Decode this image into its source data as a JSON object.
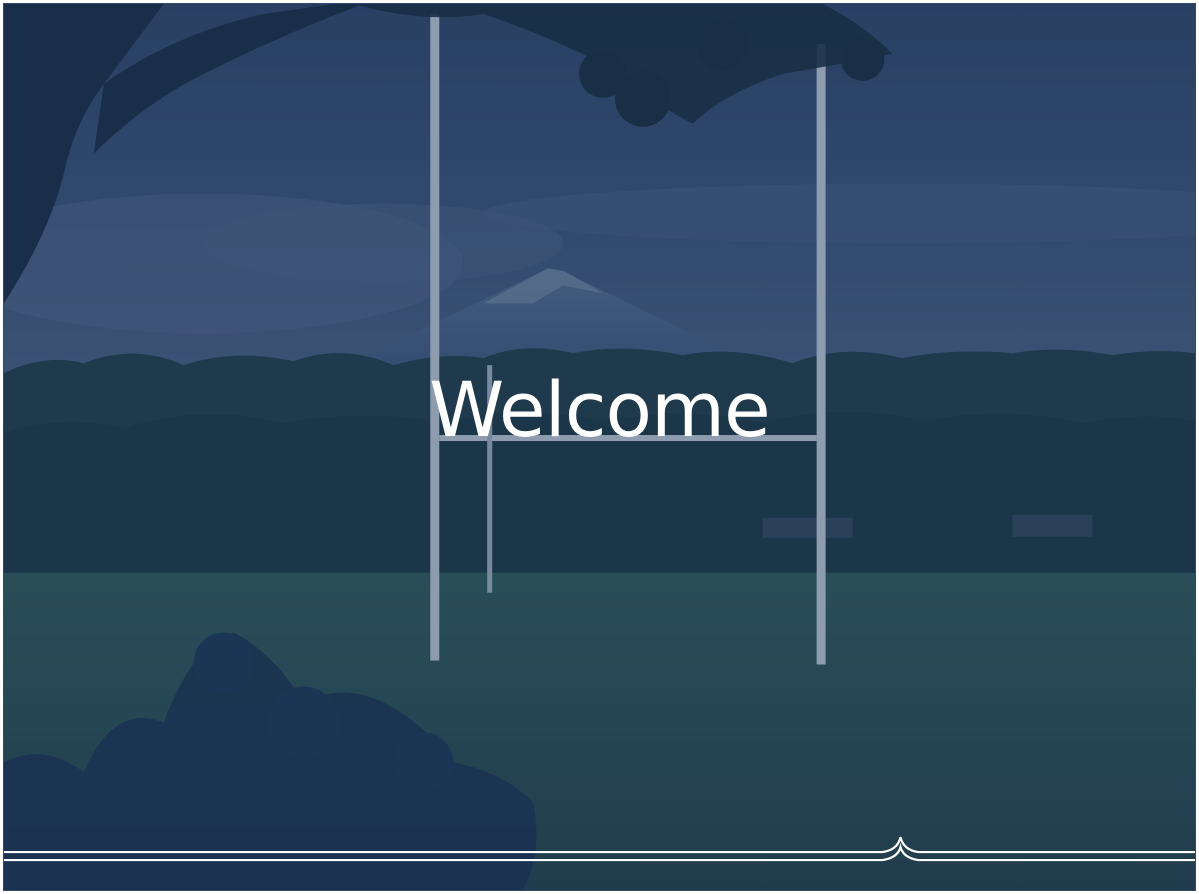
{
  "slide": {
    "title": "Welcome"
  },
  "colors": {
    "overlay": "#1f3a5e",
    "sky": "#3c5478",
    "trees": "#1d3a40",
    "field": "#2d5552",
    "text": "#ffffff"
  }
}
